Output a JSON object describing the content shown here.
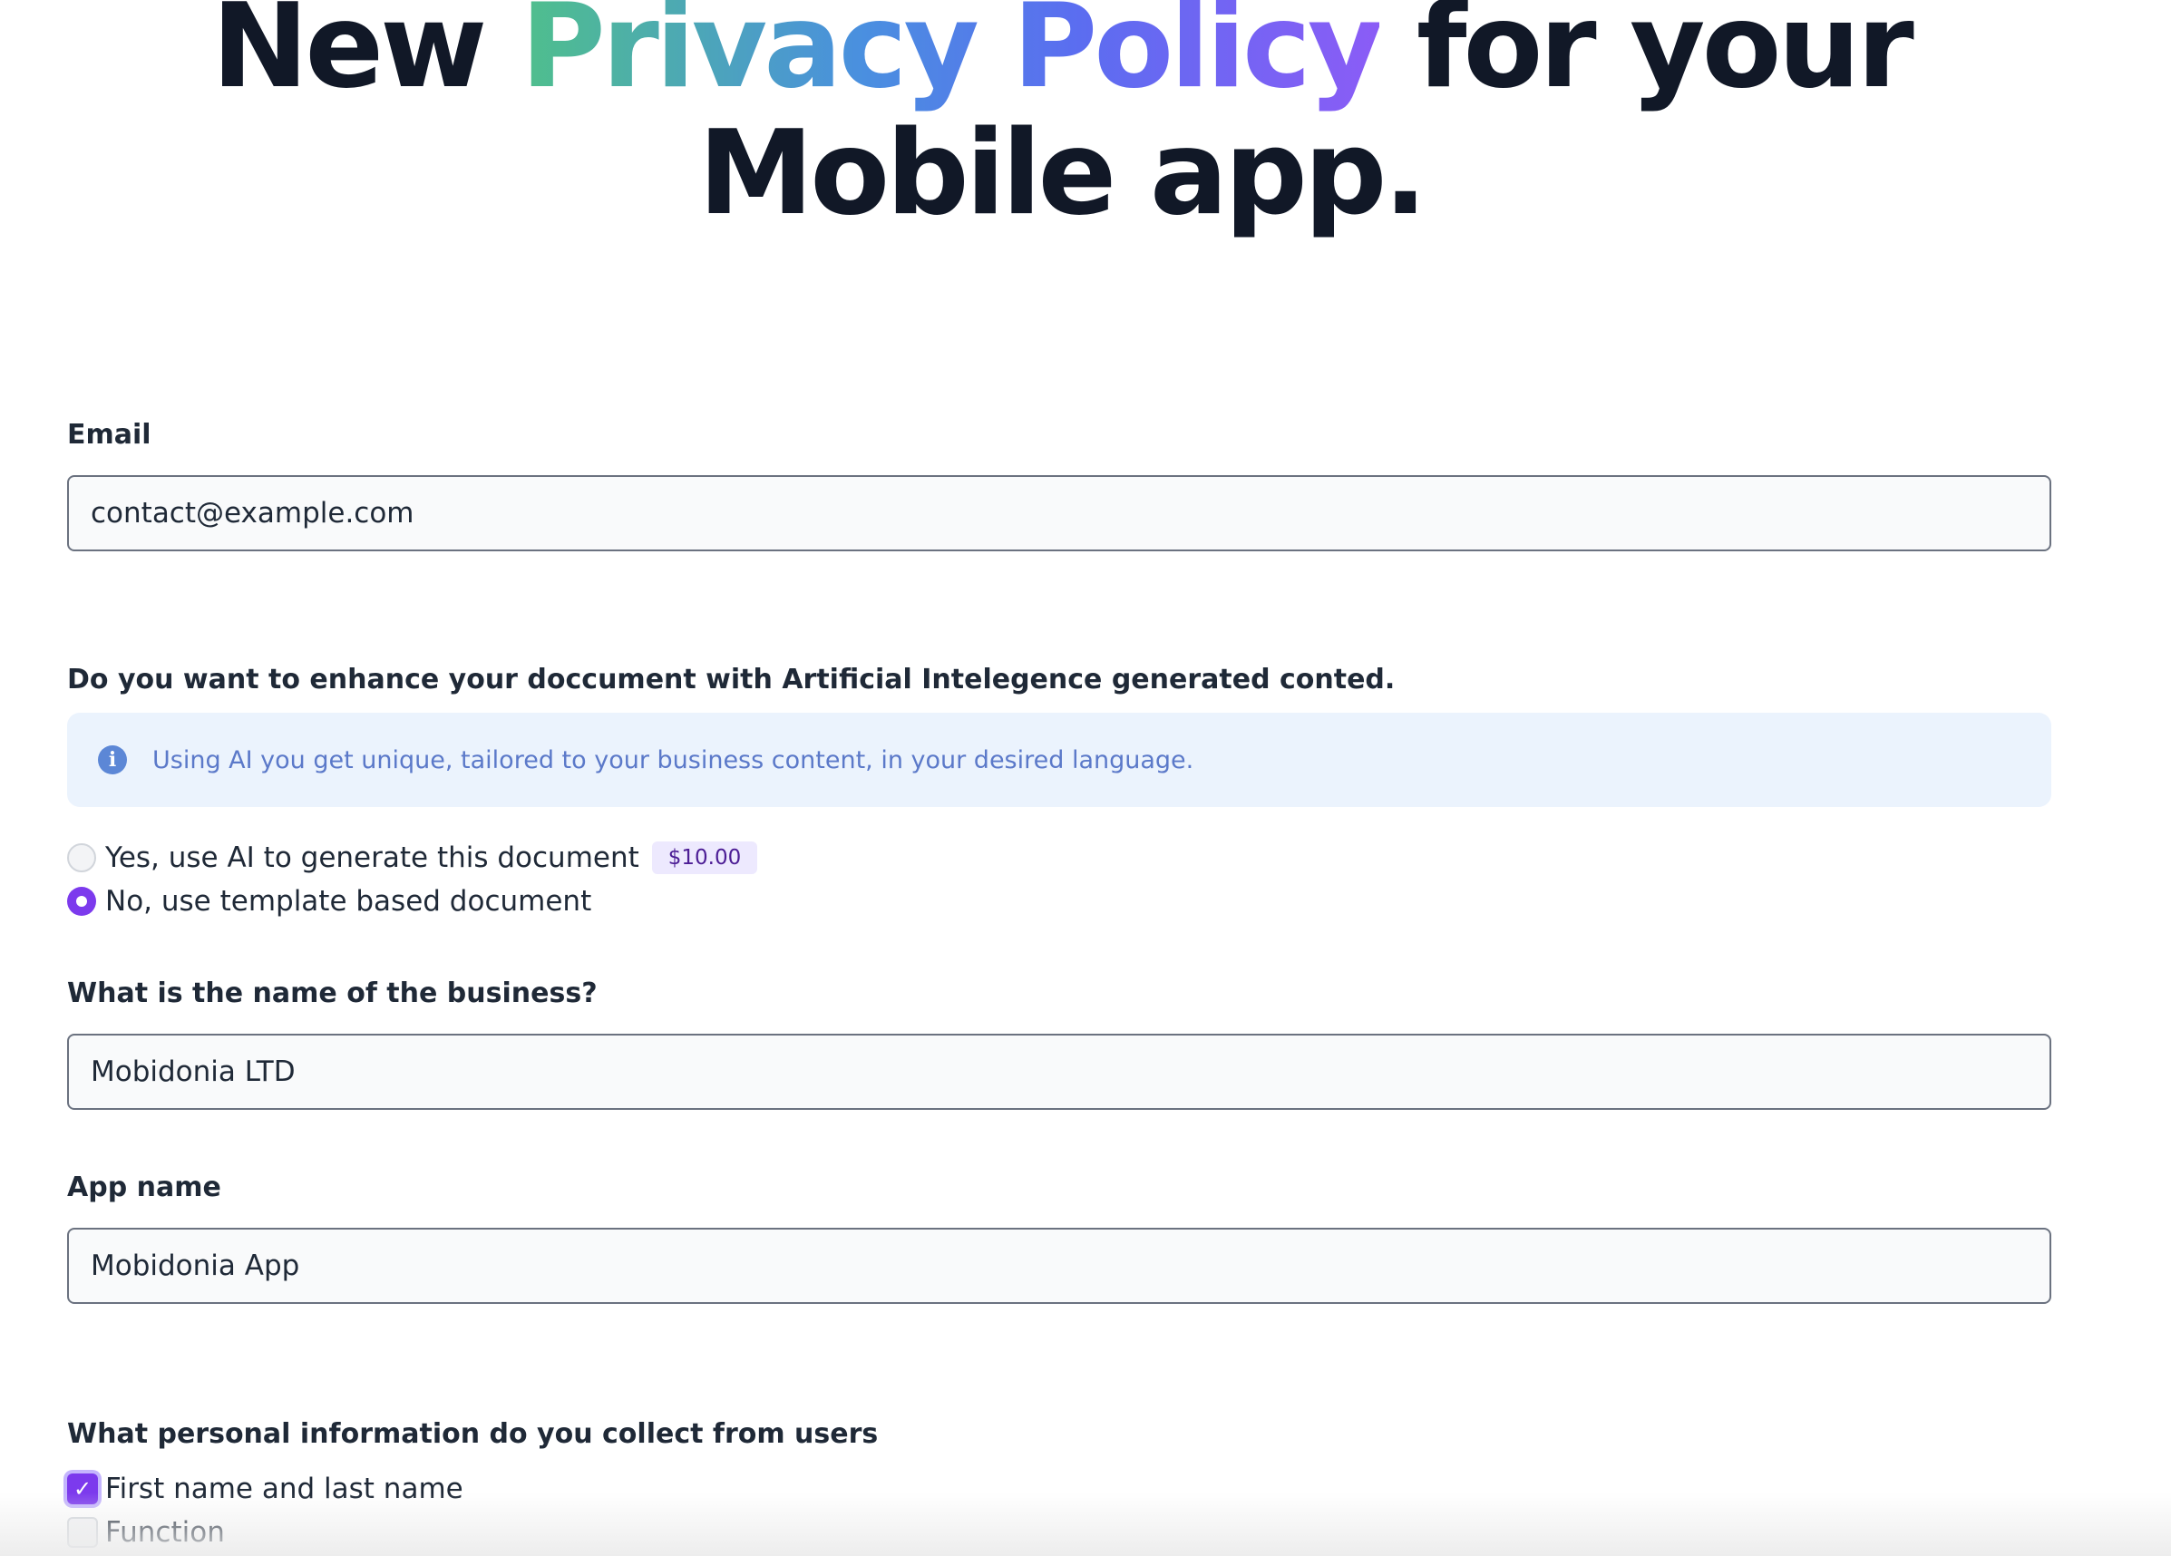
{
  "hero": {
    "line1_part1": "New ",
    "line1_highlight": "Privacy Policy",
    "line1_part2": " for your",
    "line2": "Mobile app."
  },
  "email": {
    "label": "Email",
    "value": "contact@example.com"
  },
  "ai": {
    "question": "Do you want to enhance your doccument with Artificial Intelegence generated conted.",
    "info_text": "Using AI you get unique, tailored to your business content, in your desired language.",
    "info_icon": "info-circle-icon",
    "options": [
      {
        "label": "Yes, use AI to generate this document",
        "price": "$10.00",
        "selected": false
      },
      {
        "label": "No, use template based document",
        "selected": true
      }
    ]
  },
  "business": {
    "label": "What is the name of the business?",
    "value": "Mobidonia LTD"
  },
  "app": {
    "label": "App name",
    "value": "Mobidonia App"
  },
  "personal_info": {
    "label": "What personal information do you collect from users",
    "options": [
      {
        "label": "First name and last name",
        "checked": true
      },
      {
        "label": "Function",
        "checked": false
      }
    ]
  },
  "colors": {
    "accent": "#7c3aed",
    "info_bg": "#ebf3fd",
    "info_text": "#5b79c9"
  }
}
